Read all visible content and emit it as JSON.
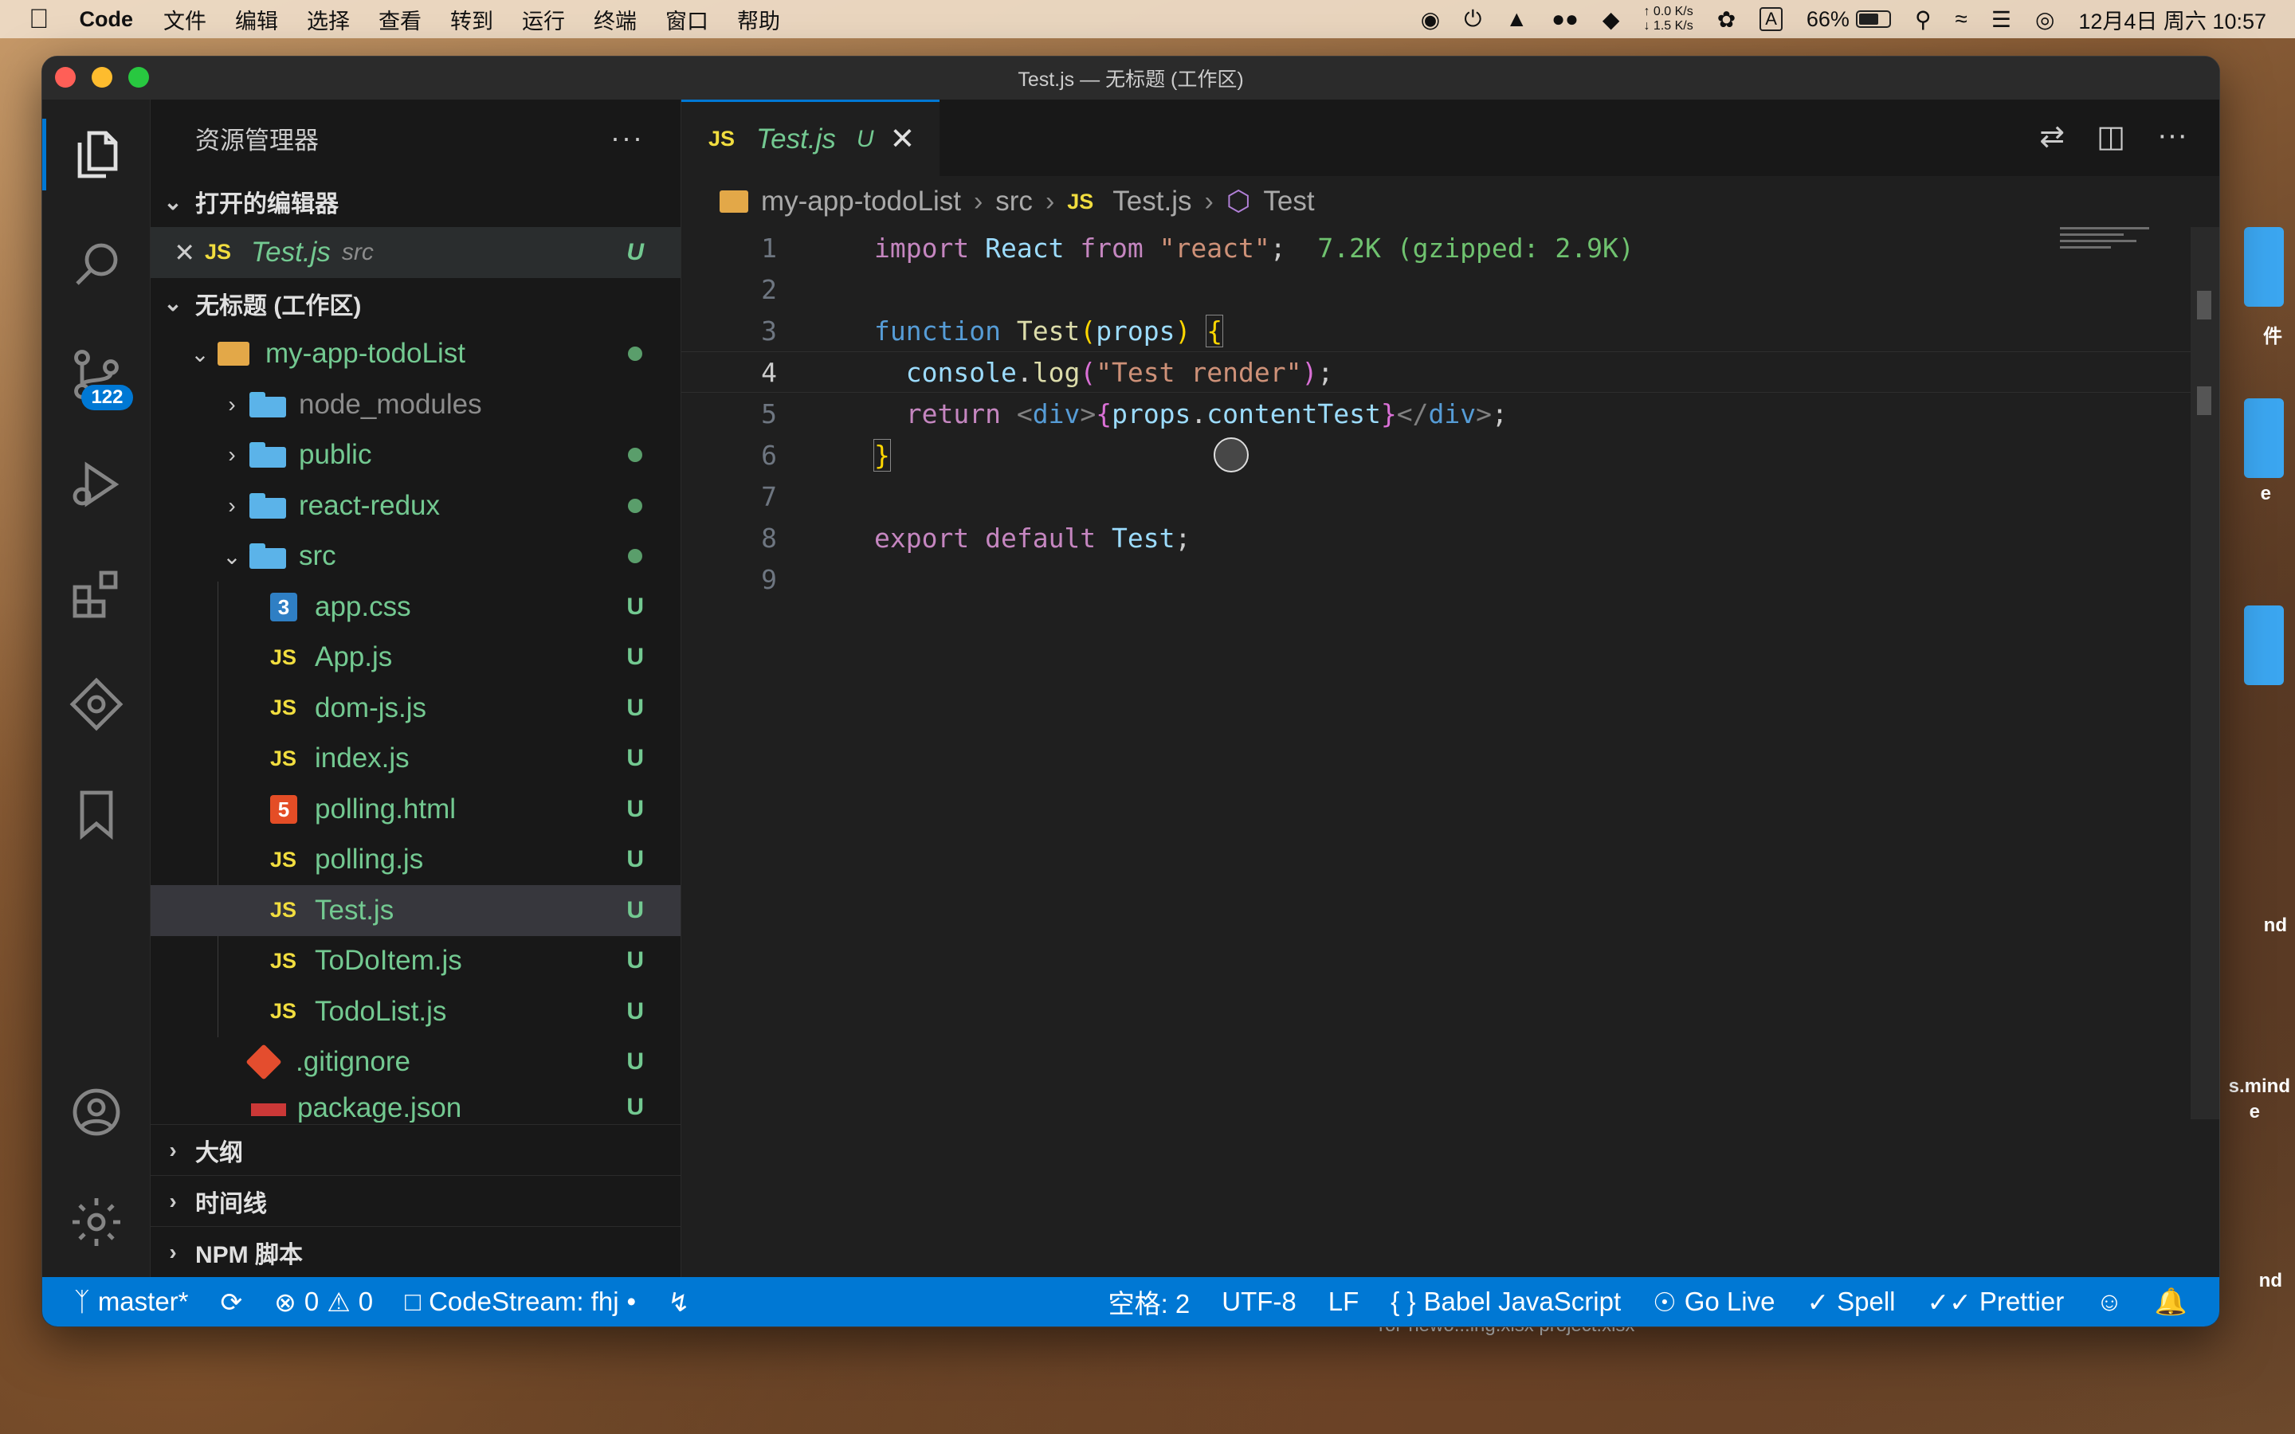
{
  "menubar": {
    "apple_icon": "apple-icon",
    "app_name": "Code",
    "menus": [
      "文件",
      "编辑",
      "选择",
      "查看",
      "转到",
      "运行",
      "终端",
      "窗口",
      "帮助"
    ],
    "netspeed_up": "0.0 K/s",
    "netspeed_down": "1.5 K/s",
    "battery_percent": "66%",
    "battery_level": 0.66,
    "datetime": "12月4日 周六 10:57"
  },
  "window": {
    "title": "Test.js — 无标题 (工作区)"
  },
  "activity": {
    "scm_badge": "122"
  },
  "sidebar": {
    "header": "资源管理器",
    "open_editors": {
      "title": "打开的编辑器",
      "items": [
        {
          "name": "Test.js",
          "dir": "src",
          "status": "U"
        }
      ]
    },
    "workspace": {
      "title": "无标题 (工作区)",
      "root": "my-app-todoList",
      "folders": [
        {
          "name": "node_modules"
        },
        {
          "name": "public"
        },
        {
          "name": "react-redux"
        },
        {
          "name": "src"
        }
      ],
      "src_files": [
        {
          "name": "app.css",
          "status": "U"
        },
        {
          "name": "App.js",
          "status": "U"
        },
        {
          "name": "dom-js.js",
          "status": "U"
        },
        {
          "name": "index.js",
          "status": "U"
        },
        {
          "name": "polling.html",
          "status": "U"
        },
        {
          "name": "polling.js",
          "status": "U"
        },
        {
          "name": "Test.js",
          "status": "U"
        },
        {
          "name": "ToDoItem.js",
          "status": "U"
        },
        {
          "name": "TodoList.js",
          "status": "U"
        }
      ],
      "root_files": [
        {
          "name": ".gitignore",
          "status": "U"
        },
        {
          "name": "package.json",
          "status": "U"
        }
      ]
    },
    "outline": "大纲",
    "timeline": "时间线",
    "npm": "NPM 脚本"
  },
  "editor": {
    "tab": {
      "name": "Test.js",
      "status": "U",
      "icon": "JS"
    },
    "breadcrumb": [
      "my-app-todoList",
      "src",
      "Test.js",
      "Test"
    ],
    "line_numbers": [
      "1",
      "2",
      "3",
      "4",
      "5",
      "6",
      "7",
      "8",
      "9"
    ],
    "import_size_hint": "7.2K (gzipped: 2.9K)"
  },
  "statusbar": {
    "branch": "master*",
    "errors": "0",
    "warnings": "0",
    "codestream": "CodeStream: fhj",
    "indent": "空格: 2",
    "encoding": "UTF-8",
    "eol": "LF",
    "language": "Babel JavaScript",
    "golive": "Go Live",
    "spell": "Spell",
    "prettier": "Prettier"
  },
  "desktop": {
    "labels": [
      "件",
      "e",
      "nd",
      "s.mind",
      "e",
      "nd"
    ],
    "bottom_text": "ror-newo...ing.xlsx    project.xlsx"
  },
  "colors": {
    "accent": "#0078d4",
    "git_untracked": "#73c991",
    "js_icon": "#f1dd3f"
  }
}
